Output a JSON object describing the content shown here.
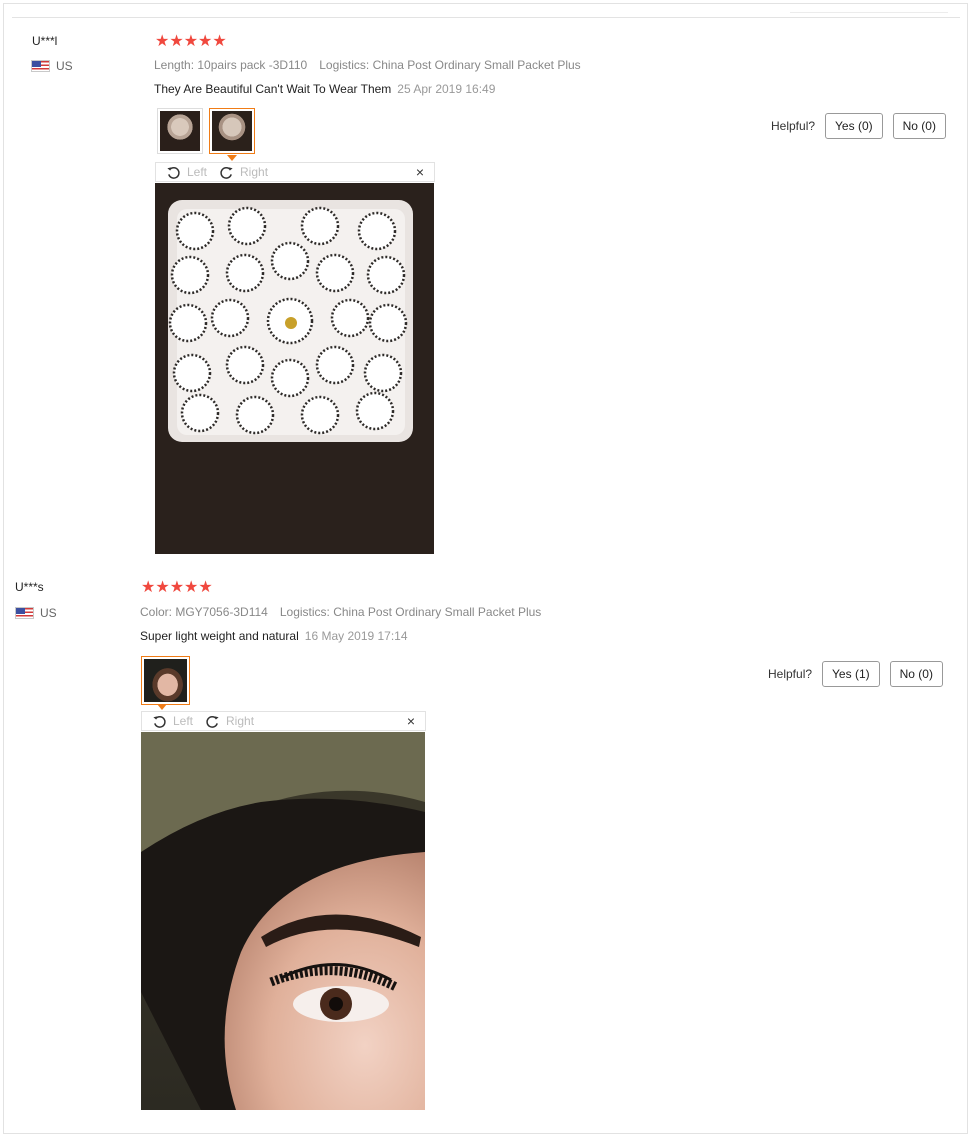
{
  "reviews": [
    {
      "user": "U***l",
      "country": "US",
      "rating": 5,
      "stars": "★★★★★",
      "attr_1": "Length: 10pairs pack -3D110",
      "logistics": "Logistics: China Post Ordinary Small Packet Plus",
      "text": "They Are Beautiful Can't Wait To Wear Them",
      "date": "25 Apr 2019 16:49",
      "helpful_label": "Helpful?",
      "yes_label": "Yes (0)",
      "no_label": "No (0)",
      "viewer": {
        "left_label": "Left",
        "right_label": "Right",
        "close_glyph": "×"
      },
      "icons": [
        "flag-us-icon",
        "rotate-left-icon",
        "rotate-right-icon",
        "close-icon"
      ]
    },
    {
      "user": "U***s",
      "country": "US",
      "rating": 5,
      "stars": "★★★★★",
      "attr_1": "Color: MGY7056-3D114",
      "logistics": "Logistics: China Post Ordinary Small Packet Plus",
      "text": "Super light weight and natural",
      "date": "16 May 2019 17:14",
      "helpful_label": "Helpful?",
      "yes_label": "Yes (1)",
      "no_label": "No (0)",
      "viewer": {
        "left_label": "Left",
        "right_label": "Right",
        "close_glyph": "×"
      },
      "icons": [
        "flag-us-icon",
        "rotate-left-icon",
        "rotate-right-icon",
        "close-icon"
      ]
    }
  ],
  "colors": {
    "star": "#f0483e",
    "accent": "#f07c16",
    "meta_text": "#888888"
  }
}
